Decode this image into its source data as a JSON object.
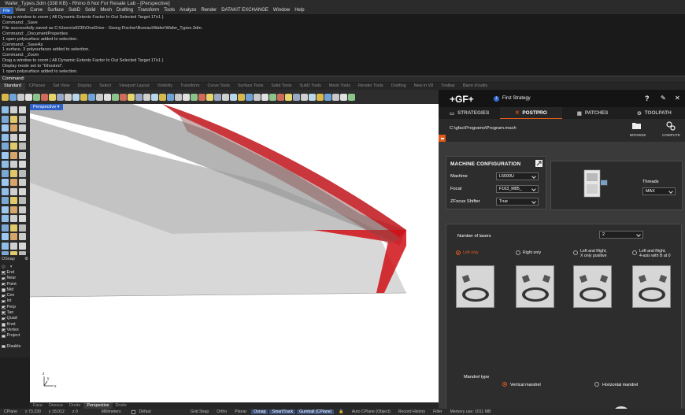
{
  "window": {
    "title": "Wafer_Types.3dm (338 KB) - Rhino 8 Not For Resale Lab - [Perspective]"
  },
  "menu": [
    "File",
    "Edit",
    "View",
    "Curve",
    "Surface",
    "SubD",
    "Solid",
    "Mesh",
    "Drafting",
    "Transform",
    "Tools",
    "Analyze",
    "Render",
    "DATAKIT EXCHANGE",
    "Window",
    "Help"
  ],
  "command_history": [
    "Drag a window to zoom ( All  Dynamic  Extents  Factor  In  Out  Selected  Target  1To1 )",
    "Command: _Save",
    "File successfully saved as C:\\Users\\sfi235\\OneDrive - Georg Fischer\\Bureau\\Wafer\\Wafer_Types.3dm.",
    "Command: _DocumentProperties",
    "1 open polysurface added to selection.",
    "Command: _SaveAs",
    "1 surface, 3 polysurfaces added to selection.",
    "Command: _Zoom",
    "Drag a window to zoom ( All  Dynamic  Extents  Factor  In  Out  Selected  Target  1To1 )",
    "Display mode set to \"Ghosted\".",
    "1 open polysurface added to selection."
  ],
  "command_prompt": "Command:",
  "toolbar_tabs": [
    "Standard",
    "CPlanes",
    "Set View",
    "Display",
    "Select",
    "Viewport Layout",
    "Visibility",
    "Transform",
    "Curve Tools",
    "Surface Tools",
    "Solid Tools",
    "SubD Tools",
    "Mesh Tools",
    "Render Tools",
    "Drafting",
    "New in V8",
    "Toolbar",
    "Barre d'outils"
  ],
  "viewport": {
    "name": "Perspective"
  },
  "osnap": {
    "title": "OSnap",
    "items": [
      {
        "label": "End",
        "checked": true
      },
      {
        "label": "Near",
        "checked": true
      },
      {
        "label": "Point",
        "checked": true
      },
      {
        "label": "Mid",
        "checked": false
      },
      {
        "label": "Cen",
        "checked": true
      },
      {
        "label": "Int",
        "checked": true
      },
      {
        "label": "Perp",
        "checked": true
      },
      {
        "label": "Tan",
        "checked": true
      },
      {
        "label": "Quad",
        "checked": true
      },
      {
        "label": "Knot",
        "checked": false
      },
      {
        "label": "Vertex",
        "checked": true
      },
      {
        "label": "Project",
        "checked": false
      }
    ],
    "disable_label": "Disable"
  },
  "viewport_tabs": [
    "Face",
    "Dessus",
    "Droite",
    "Perspective",
    "Droite"
  ],
  "axes": {
    "x": "x",
    "y": "y",
    "z": "z"
  },
  "status": {
    "cplane": "CPlane",
    "x": "x 73.230",
    "y": "y 18.012",
    "z": "z 0",
    "units": "Millimeters",
    "layer": "Défaut",
    "grid_snap": "Grid Snap",
    "ortho": "Ortho",
    "planar": "Planar",
    "osnap": "Osnap",
    "smarttrack": "SmartTrack",
    "gumball": "Gumball (CPlane)",
    "autocplane": "Auto CPlane (Object)",
    "record_history": "Record History",
    "filter": "Filter",
    "memory": "Memory use: 1011 MB"
  },
  "gf": {
    "logo": "+GF+",
    "strategy": "First Strategy",
    "help": "?",
    "tabs": [
      {
        "label": "STRATEGIES"
      },
      {
        "label": "POSTPRO"
      },
      {
        "label": "PATCHES"
      },
      {
        "label": "TOOLPATH"
      }
    ],
    "path": "C:\\gfac\\Programs\\Program.mach",
    "browse": "BROWSE",
    "compute": "COMPUTE",
    "machine_config": {
      "title": "MACHINE CONFIGURATION",
      "machine_label": "Machine",
      "machine_value": "L5500U",
      "focal_label": "Focal",
      "focal_value": "F163_M85_",
      "zfocus_label": "ZFocus Shifter",
      "zfocus_value": "True",
      "threads_label": "Threads",
      "threads_value": "MAX"
    },
    "lasers": {
      "label": "Number of lasers",
      "value": "2",
      "options": [
        {
          "label": "Left only",
          "selected": true
        },
        {
          "label": "Right only",
          "selected": false
        },
        {
          "label": "Left and Right,\nX only positive",
          "selected": false
        },
        {
          "label": "Left and Right,\n4-axis with B at 0",
          "selected": false
        }
      ]
    },
    "mandrel": {
      "label": "Mandrel type",
      "options": [
        {
          "label": "Vertical mandrel",
          "selected": true
        },
        {
          "label": "Horizontal mandrel",
          "selected": false
        }
      ]
    },
    "accent": "#e05a1c"
  }
}
